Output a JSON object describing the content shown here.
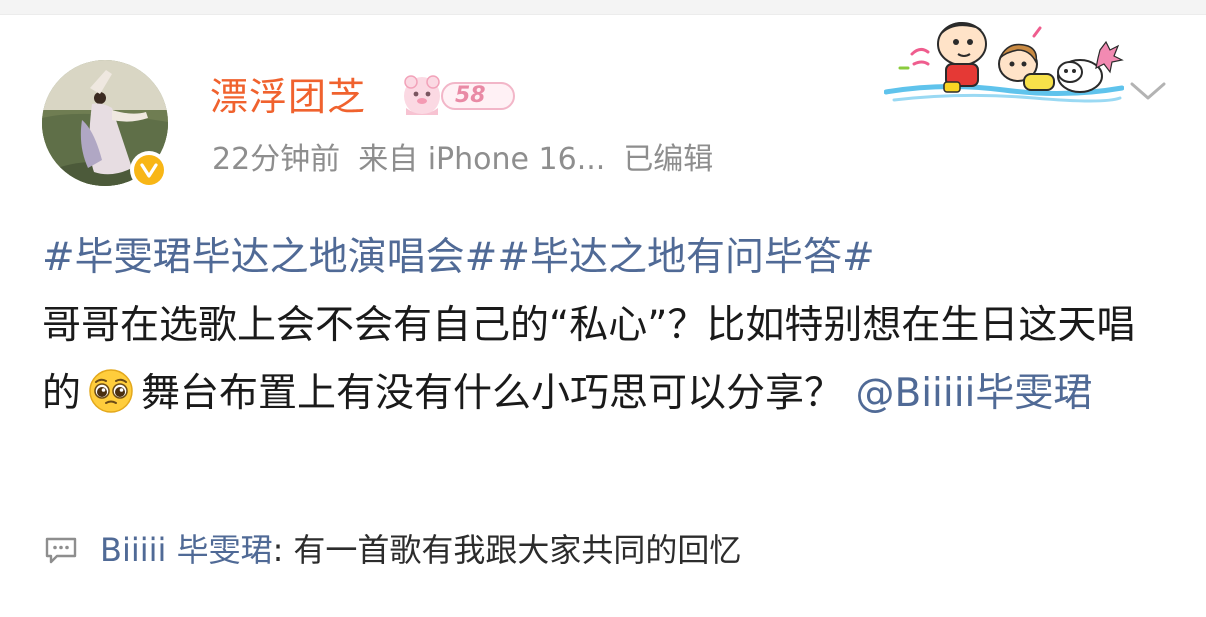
{
  "post": {
    "author": "漂浮团芝",
    "badge_level": "58",
    "time": "22分钟前",
    "source": "来自 iPhone 16...",
    "edited": "已编辑",
    "topic_1": "#毕雯珺毕达之地演唱会#",
    "topic_2": "#毕达之地有问毕答#",
    "text_part_1": "哥哥在选歌上会不会有自己的“私心”？比如特别想在生日这天唱的",
    "text_part_2": "舞台布置上有没有什么小巧思可以分享？",
    "mention": "@Biiiii毕雯珺",
    "icons": {
      "verified": "verified-badge-icon",
      "emoji": "pleading-face-emoji",
      "menu": "chevron-down-icon",
      "comment": "comment-icon"
    }
  },
  "top_comment": {
    "author": "Biiiii 毕雯珺",
    "separator": ":",
    "text": "有一首歌有我跟大家共同的回忆"
  },
  "colors": {
    "username": "#f0622e",
    "link": "#506a96",
    "meta": "#8e8e8e",
    "verified": "#f8b616"
  }
}
